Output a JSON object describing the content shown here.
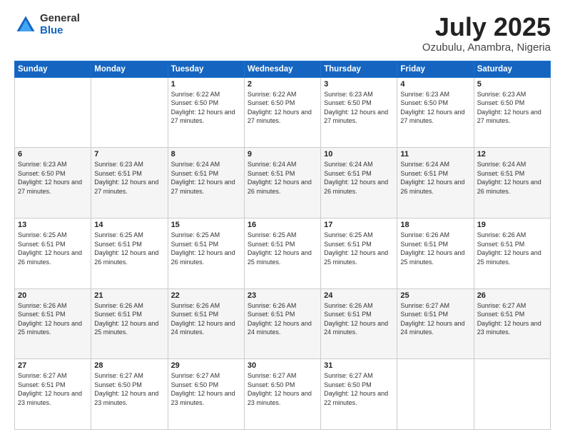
{
  "logo": {
    "general": "General",
    "blue": "Blue"
  },
  "title": {
    "month": "July 2025",
    "location": "Ozubulu, Anambra, Nigeria"
  },
  "weekdays": [
    "Sunday",
    "Monday",
    "Tuesday",
    "Wednesday",
    "Thursday",
    "Friday",
    "Saturday"
  ],
  "weeks": [
    [
      {
        "day": "",
        "info": ""
      },
      {
        "day": "",
        "info": ""
      },
      {
        "day": "1",
        "info": "Sunrise: 6:22 AM\nSunset: 6:50 PM\nDaylight: 12 hours and 27 minutes."
      },
      {
        "day": "2",
        "info": "Sunrise: 6:22 AM\nSunset: 6:50 PM\nDaylight: 12 hours and 27 minutes."
      },
      {
        "day": "3",
        "info": "Sunrise: 6:23 AM\nSunset: 6:50 PM\nDaylight: 12 hours and 27 minutes."
      },
      {
        "day": "4",
        "info": "Sunrise: 6:23 AM\nSunset: 6:50 PM\nDaylight: 12 hours and 27 minutes."
      },
      {
        "day": "5",
        "info": "Sunrise: 6:23 AM\nSunset: 6:50 PM\nDaylight: 12 hours and 27 minutes."
      }
    ],
    [
      {
        "day": "6",
        "info": "Sunrise: 6:23 AM\nSunset: 6:50 PM\nDaylight: 12 hours and 27 minutes."
      },
      {
        "day": "7",
        "info": "Sunrise: 6:23 AM\nSunset: 6:51 PM\nDaylight: 12 hours and 27 minutes."
      },
      {
        "day": "8",
        "info": "Sunrise: 6:24 AM\nSunset: 6:51 PM\nDaylight: 12 hours and 27 minutes."
      },
      {
        "day": "9",
        "info": "Sunrise: 6:24 AM\nSunset: 6:51 PM\nDaylight: 12 hours and 26 minutes."
      },
      {
        "day": "10",
        "info": "Sunrise: 6:24 AM\nSunset: 6:51 PM\nDaylight: 12 hours and 26 minutes."
      },
      {
        "day": "11",
        "info": "Sunrise: 6:24 AM\nSunset: 6:51 PM\nDaylight: 12 hours and 26 minutes."
      },
      {
        "day": "12",
        "info": "Sunrise: 6:24 AM\nSunset: 6:51 PM\nDaylight: 12 hours and 26 minutes."
      }
    ],
    [
      {
        "day": "13",
        "info": "Sunrise: 6:25 AM\nSunset: 6:51 PM\nDaylight: 12 hours and 26 minutes."
      },
      {
        "day": "14",
        "info": "Sunrise: 6:25 AM\nSunset: 6:51 PM\nDaylight: 12 hours and 26 minutes."
      },
      {
        "day": "15",
        "info": "Sunrise: 6:25 AM\nSunset: 6:51 PM\nDaylight: 12 hours and 26 minutes."
      },
      {
        "day": "16",
        "info": "Sunrise: 6:25 AM\nSunset: 6:51 PM\nDaylight: 12 hours and 25 minutes."
      },
      {
        "day": "17",
        "info": "Sunrise: 6:25 AM\nSunset: 6:51 PM\nDaylight: 12 hours and 25 minutes."
      },
      {
        "day": "18",
        "info": "Sunrise: 6:26 AM\nSunset: 6:51 PM\nDaylight: 12 hours and 25 minutes."
      },
      {
        "day": "19",
        "info": "Sunrise: 6:26 AM\nSunset: 6:51 PM\nDaylight: 12 hours and 25 minutes."
      }
    ],
    [
      {
        "day": "20",
        "info": "Sunrise: 6:26 AM\nSunset: 6:51 PM\nDaylight: 12 hours and 25 minutes."
      },
      {
        "day": "21",
        "info": "Sunrise: 6:26 AM\nSunset: 6:51 PM\nDaylight: 12 hours and 25 minutes."
      },
      {
        "day": "22",
        "info": "Sunrise: 6:26 AM\nSunset: 6:51 PM\nDaylight: 12 hours and 24 minutes."
      },
      {
        "day": "23",
        "info": "Sunrise: 6:26 AM\nSunset: 6:51 PM\nDaylight: 12 hours and 24 minutes."
      },
      {
        "day": "24",
        "info": "Sunrise: 6:26 AM\nSunset: 6:51 PM\nDaylight: 12 hours and 24 minutes."
      },
      {
        "day": "25",
        "info": "Sunrise: 6:27 AM\nSunset: 6:51 PM\nDaylight: 12 hours and 24 minutes."
      },
      {
        "day": "26",
        "info": "Sunrise: 6:27 AM\nSunset: 6:51 PM\nDaylight: 12 hours and 23 minutes."
      }
    ],
    [
      {
        "day": "27",
        "info": "Sunrise: 6:27 AM\nSunset: 6:51 PM\nDaylight: 12 hours and 23 minutes."
      },
      {
        "day": "28",
        "info": "Sunrise: 6:27 AM\nSunset: 6:50 PM\nDaylight: 12 hours and 23 minutes."
      },
      {
        "day": "29",
        "info": "Sunrise: 6:27 AM\nSunset: 6:50 PM\nDaylight: 12 hours and 23 minutes."
      },
      {
        "day": "30",
        "info": "Sunrise: 6:27 AM\nSunset: 6:50 PM\nDaylight: 12 hours and 23 minutes."
      },
      {
        "day": "31",
        "info": "Sunrise: 6:27 AM\nSunset: 6:50 PM\nDaylight: 12 hours and 22 minutes."
      },
      {
        "day": "",
        "info": ""
      },
      {
        "day": "",
        "info": ""
      }
    ]
  ]
}
